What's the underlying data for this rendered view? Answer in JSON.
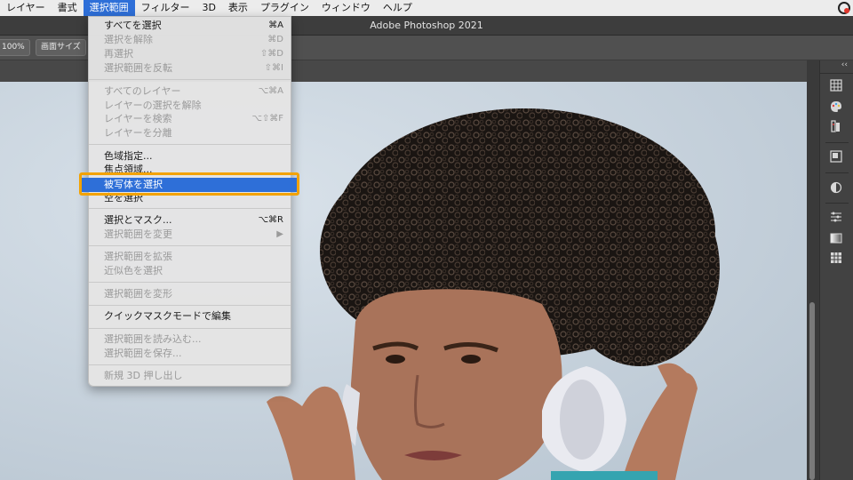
{
  "menubar": {
    "items": [
      "レイヤー",
      "書式",
      "選択範囲",
      "フィルター",
      "3D",
      "表示",
      "プラグイン",
      "ウィンドウ",
      "ヘルプ"
    ],
    "active_index": 2
  },
  "app_title": "Adobe Photoshop 2021",
  "options": {
    "zoom_label": "100%",
    "fit_label": "画面サイズ"
  },
  "menu": {
    "items": [
      {
        "label": "すべてを選択",
        "shortcut": "⌘A",
        "enabled": true
      },
      {
        "label": "選択を解除",
        "shortcut": "⌘D",
        "enabled": false
      },
      {
        "label": "再選択",
        "shortcut": "⇧⌘D",
        "enabled": false
      },
      {
        "label": "選択範囲を反転",
        "shortcut": "⇧⌘I",
        "enabled": false
      },
      {
        "label": "すべてのレイヤー",
        "shortcut": "⌥⌘A",
        "enabled": false
      },
      {
        "label": "レイヤーの選択を解除",
        "shortcut": "",
        "enabled": false
      },
      {
        "label": "レイヤーを検索",
        "shortcut": "⌥⇧⌘F",
        "enabled": false
      },
      {
        "label": "レイヤーを分離",
        "shortcut": "",
        "enabled": false
      },
      {
        "label": "色域指定...",
        "shortcut": "",
        "enabled": true
      },
      {
        "label": "焦点領域...",
        "shortcut": "",
        "enabled": true
      },
      {
        "label": "被写体を選択",
        "shortcut": "",
        "enabled": true,
        "highlighted": true
      },
      {
        "label": "空を選択",
        "shortcut": "",
        "enabled": true
      },
      {
        "label": "選択とマスク...",
        "shortcut": "⌥⌘R",
        "enabled": true
      },
      {
        "label": "選択範囲を変更",
        "shortcut": "▶",
        "enabled": false
      },
      {
        "label": "選択範囲を拡張",
        "shortcut": "",
        "enabled": false
      },
      {
        "label": "近似色を選択",
        "shortcut": "",
        "enabled": false
      },
      {
        "label": "選択範囲を変形",
        "shortcut": "",
        "enabled": false
      },
      {
        "label": "クイックマスクモードで編集",
        "shortcut": "",
        "enabled": true
      },
      {
        "label": "選択範囲を読み込む...",
        "shortcut": "",
        "enabled": false
      },
      {
        "label": "選択範囲を保存...",
        "shortcut": "",
        "enabled": false
      },
      {
        "label": "新規 3D 押し出し",
        "shortcut": "",
        "enabled": false
      }
    ]
  },
  "dock_icons": [
    "table-icon",
    "palette-icon",
    "libraries-icon",
    "panel-icon",
    "adjust-icon",
    "sliders-icon",
    "gradient-icon",
    "grid-icon"
  ],
  "colors": {
    "accent": "#2e6fd8",
    "callout": "#f3a200"
  }
}
